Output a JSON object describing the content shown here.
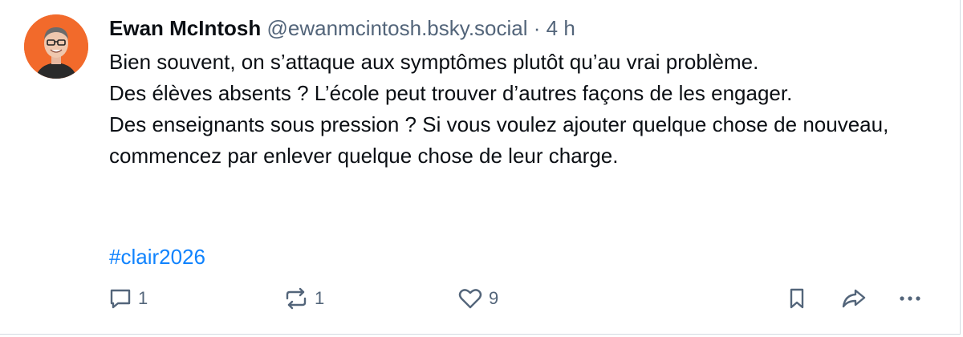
{
  "post": {
    "author_name": "Ewan McIntosh",
    "handle": "@ewanmcintosh.bsky.social",
    "separator": "·",
    "timestamp": "4 h",
    "lines": [
      "Bien souvent, on s’attaque aux symptômes plutôt qu’au vrai problème.",
      "Des élèves absents ? L’école peut trouver d’autres façons de les engager.",
      "Des enseignants sous pression ? Si vous voulez ajouter quelque chose de nouveau, commencez par enlever quelque chose de leur charge."
    ],
    "hashtag": "#clair2026"
  },
  "actions": {
    "reply_count": "1",
    "repost_count": "1",
    "like_count": "9"
  },
  "colors": {
    "avatar_bg": "#f26a2b",
    "hashtag": "#1083fe",
    "muted": "#53657a"
  },
  "icons": [
    "chat-bubble-icon",
    "repost-icon",
    "heart-icon",
    "bookmark-icon",
    "share-arrow-icon",
    "ellipsis-icon"
  ]
}
